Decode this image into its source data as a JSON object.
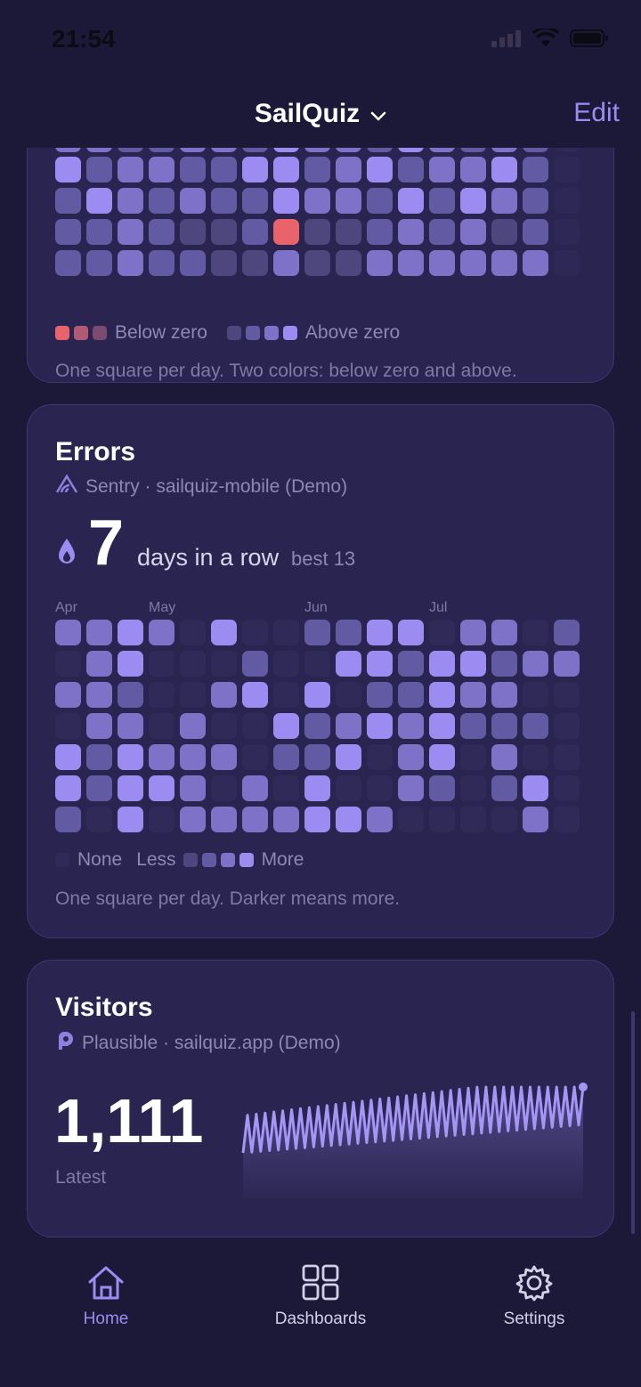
{
  "status": {
    "time": "21:54"
  },
  "nav": {
    "title": "SailQuiz",
    "edit": "Edit"
  },
  "temperature_card": {
    "legend_below": "Below zero",
    "legend_above": "Above zero",
    "caption": "One square per day. Two colors: below zero and above."
  },
  "errors_card": {
    "title": "Errors",
    "source": "Sentry · sailquiz-mobile (Demo)",
    "streak_value": "7",
    "streak_label": "days in a row",
    "best": "best 13",
    "months": [
      "Apr",
      "May",
      "Jun",
      "Jul"
    ],
    "legend_none": "None",
    "legend_less": "Less",
    "legend_more": "More",
    "caption": "One square per day. Darker means more."
  },
  "visitors_card": {
    "title": "Visitors",
    "source": "Plausible · sailquiz.app (Demo)",
    "value": "1,111",
    "value_label": "Latest"
  },
  "tabs": [
    {
      "label": "Home",
      "active": true
    },
    {
      "label": "Dashboards",
      "active": false
    },
    {
      "label": "Settings",
      "active": false
    }
  ],
  "colors": {
    "accent": "#9c8cf2",
    "background": "#1c1838",
    "card": "#2a2550",
    "below_zero": "#e8646a"
  }
}
